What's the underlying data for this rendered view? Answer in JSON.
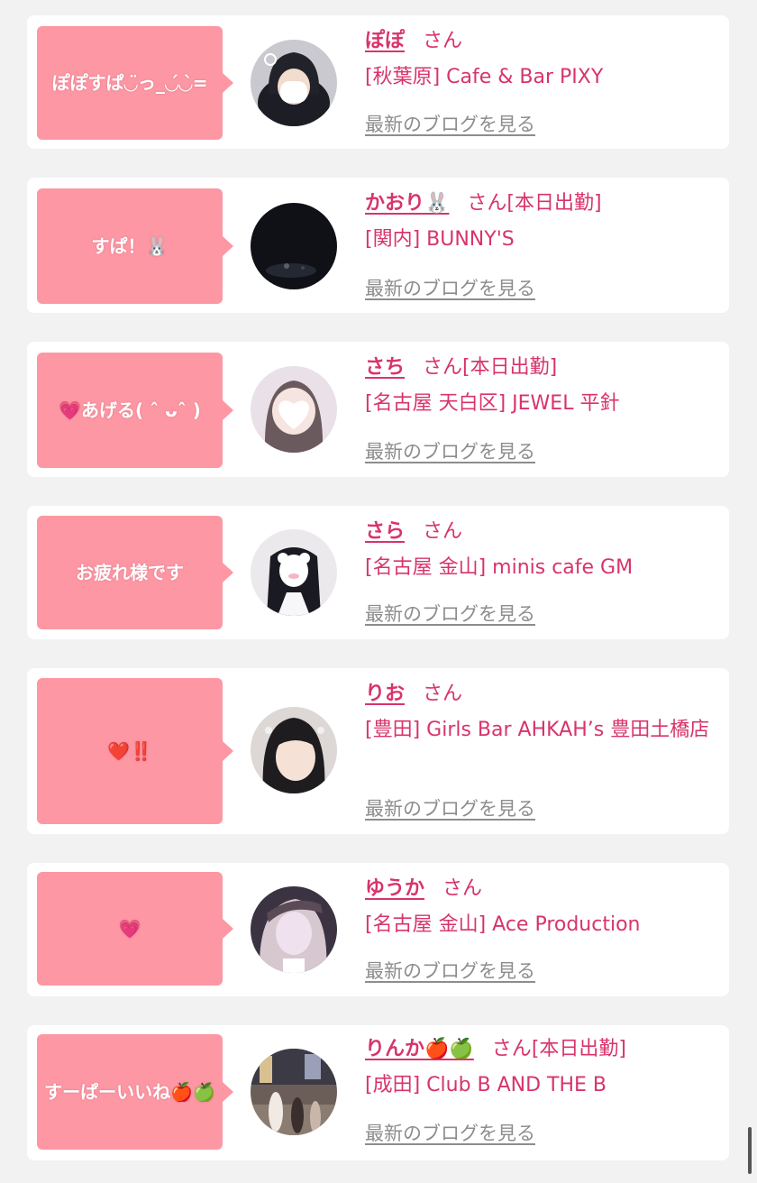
{
  "posts": [
    {
      "bubble": "ぽぽすぱ◡̈っ_◡́◡̀=",
      "name": "ぽぽ",
      "san": "さん",
      "status": "",
      "shop": "[秋葉原] Cafe & Bar PIXY",
      "blog": "最新のブログを見る",
      "avatar": "masked-face-dark-hair"
    },
    {
      "bubble": "すぱ！🐰",
      "name": "かおり🐰",
      "san": "さん",
      "status": "[本日出勤]",
      "shop": "[関内] BUNNY'S",
      "blog": "最新のブログを見る",
      "avatar": "night-scene"
    },
    {
      "bubble": "💗あげる( ˆ ᴗˆ )",
      "name": "さち",
      "san": "さん",
      "status": "[本日出勤]",
      "shop": "[名古屋 天白区] JEWEL 平針",
      "blog": "最新のブログを見る",
      "avatar": "heart-sticker-face"
    },
    {
      "bubble": "お疲れ様です",
      "name": "さら",
      "san": "さん",
      "status": "",
      "shop": "[名古屋 金山] minis cafe GM",
      "blog": "最新のブログを見る",
      "avatar": "plush-covered-face"
    },
    {
      "bubble": "❤️‼️",
      "name": "りお",
      "san": "さん",
      "status": "",
      "shop": "[豊田] Girls Bar AHKAH’s 豊田土橋店",
      "blog": "最新のブログを見る",
      "avatar": "selfie-bangs"
    },
    {
      "bubble": "💗",
      "name": "ゆうか",
      "san": "さん",
      "status": "",
      "shop": "[名古屋 金山] Ace Production",
      "blog": "最新のブログを見る",
      "avatar": "wink-selfie"
    },
    {
      "bubble": "すーぱーいいね🍎🍏",
      "name": "りんか🍎🍏",
      "san": "さん",
      "status": "[本日出勤]",
      "shop": "[成田] Club B AND THE B",
      "blog": "最新のブログを見る",
      "avatar": "street-photo"
    }
  ],
  "colors": {
    "accent": "#d8346a",
    "bubble": "#fd97a4",
    "link": "#8d8d8d",
    "background": "#f2f2f2"
  }
}
